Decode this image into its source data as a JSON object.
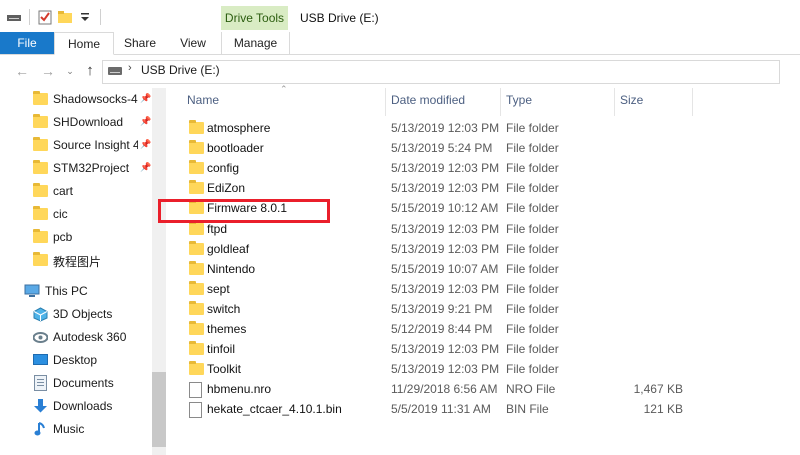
{
  "window": {
    "title": "USB Drive (E:)",
    "context_group": "Drive Tools"
  },
  "ribbon": {
    "tabs": [
      "File",
      "Home",
      "Share",
      "View",
      "Manage"
    ]
  },
  "address": {
    "path": "USB Drive (E:)"
  },
  "nav": {
    "quick_access": [
      {
        "label": "Shadowsocks-4.",
        "pinned": true
      },
      {
        "label": "SHDownload",
        "pinned": true
      },
      {
        "label": "Source Insight 4.",
        "pinned": true
      },
      {
        "label": "STM32Project",
        "pinned": true
      },
      {
        "label": "cart",
        "pinned": false
      },
      {
        "label": "cic",
        "pinned": false
      },
      {
        "label": "pcb",
        "pinned": false
      },
      {
        "label": "教程图片",
        "pinned": false
      }
    ],
    "this_pc": {
      "label": "This PC"
    },
    "pc_items": [
      {
        "label": "3D Objects",
        "icon": "3d-objects-icon"
      },
      {
        "label": "Autodesk 360",
        "icon": "autodesk-icon"
      },
      {
        "label": "Desktop",
        "icon": "desktop-icon"
      },
      {
        "label": "Documents",
        "icon": "documents-icon"
      },
      {
        "label": "Downloads",
        "icon": "downloads-icon"
      },
      {
        "label": "Music",
        "icon": "music-icon"
      }
    ]
  },
  "columns": {
    "name": "Name",
    "date": "Date modified",
    "type": "Type",
    "size": "Size"
  },
  "files": [
    {
      "name": "atmosphere",
      "date": "5/13/2019 12:03 PM",
      "type": "File folder",
      "size": "",
      "kind": "folder"
    },
    {
      "name": "bootloader",
      "date": "5/13/2019 5:24 PM",
      "type": "File folder",
      "size": "",
      "kind": "folder"
    },
    {
      "name": "config",
      "date": "5/13/2019 12:03 PM",
      "type": "File folder",
      "size": "",
      "kind": "folder"
    },
    {
      "name": "EdiZon",
      "date": "5/13/2019 12:03 PM",
      "type": "File folder",
      "size": "",
      "kind": "folder"
    },
    {
      "name": "Firmware 8.0.1",
      "date": "5/15/2019 10:12 AM",
      "type": "File folder",
      "size": "",
      "kind": "folder"
    },
    {
      "name": "ftpd",
      "date": "5/13/2019 12:03 PM",
      "type": "File folder",
      "size": "",
      "kind": "folder"
    },
    {
      "name": "goldleaf",
      "date": "5/13/2019 12:03 PM",
      "type": "File folder",
      "size": "",
      "kind": "folder"
    },
    {
      "name": "Nintendo",
      "date": "5/15/2019 10:07 AM",
      "type": "File folder",
      "size": "",
      "kind": "folder"
    },
    {
      "name": "sept",
      "date": "5/13/2019 12:03 PM",
      "type": "File folder",
      "size": "",
      "kind": "folder"
    },
    {
      "name": "switch",
      "date": "5/13/2019 9:21 PM",
      "type": "File folder",
      "size": "",
      "kind": "folder"
    },
    {
      "name": "themes",
      "date": "5/12/2019 8:44 PM",
      "type": "File folder",
      "size": "",
      "kind": "folder"
    },
    {
      "name": "tinfoil",
      "date": "5/13/2019 12:03 PM",
      "type": "File folder",
      "size": "",
      "kind": "folder"
    },
    {
      "name": "Toolkit",
      "date": "5/13/2019 12:03 PM",
      "type": "File folder",
      "size": "",
      "kind": "folder"
    },
    {
      "name": "hbmenu.nro",
      "date": "11/29/2018 6:56 AM",
      "type": "NRO File",
      "size": "1,467 KB",
      "kind": "file"
    },
    {
      "name": "hekate_ctcaer_4.10.1.bin",
      "date": "5/5/2019 11:31 AM",
      "type": "BIN File",
      "size": "121 KB",
      "kind": "file"
    }
  ],
  "colors": {
    "file_tab": "#1979ca",
    "context_tab": "#d9ecc4",
    "folder": "#ffd75a",
    "highlight": "#ea1f2b",
    "header_text": "#4d6082"
  }
}
